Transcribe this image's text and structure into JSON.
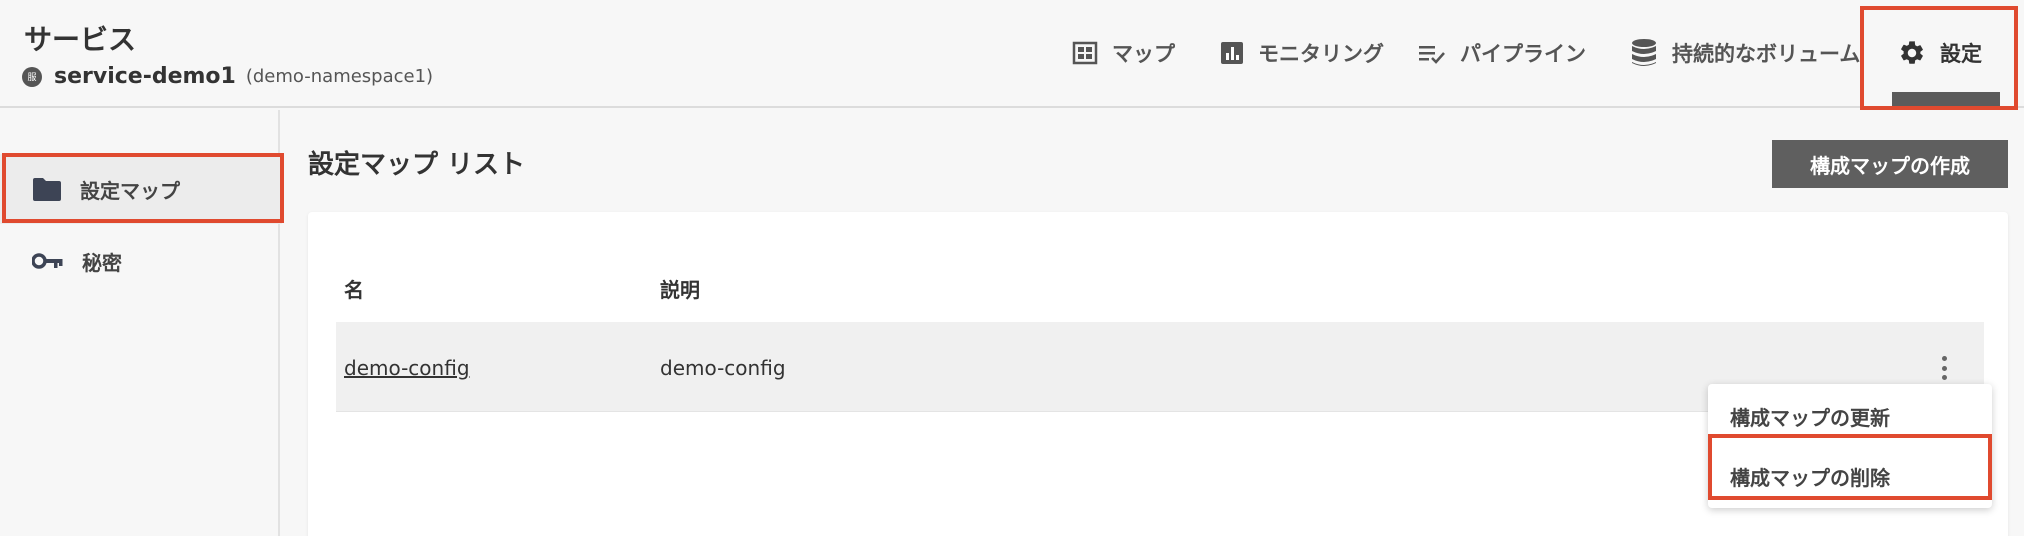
{
  "header": {
    "title": "サービス",
    "service_avatar_text": "服",
    "service_name": "service-demo1",
    "namespace": "(demo-namespace1)"
  },
  "nav": {
    "items": [
      {
        "label": "マップ",
        "icon": "map-icon"
      },
      {
        "label": "モニタリング",
        "icon": "chart-icon"
      },
      {
        "label": "パイプライン",
        "icon": "pipeline-icon"
      },
      {
        "label": "持続的なボリューム",
        "icon": "database-icon"
      },
      {
        "label": "設定",
        "icon": "gear-icon",
        "active": true
      }
    ]
  },
  "sidebar": {
    "items": [
      {
        "label": "設定マップ",
        "icon": "folder-icon",
        "active": true
      },
      {
        "label": "秘密",
        "icon": "key-icon"
      }
    ]
  },
  "main": {
    "heading": "設定マップ リスト",
    "create_button": "構成マップの作成",
    "table": {
      "columns": [
        "名",
        "説明"
      ],
      "rows": [
        {
          "name": "demo-config",
          "description": "demo-config"
        }
      ]
    },
    "row_menu": {
      "items": [
        "構成マップの更新",
        "構成マップの削除"
      ]
    }
  },
  "colors": {
    "highlight": "#e04a2f",
    "button_bg": "#5f5f5f",
    "nav_underline": "#5b5b5b"
  }
}
